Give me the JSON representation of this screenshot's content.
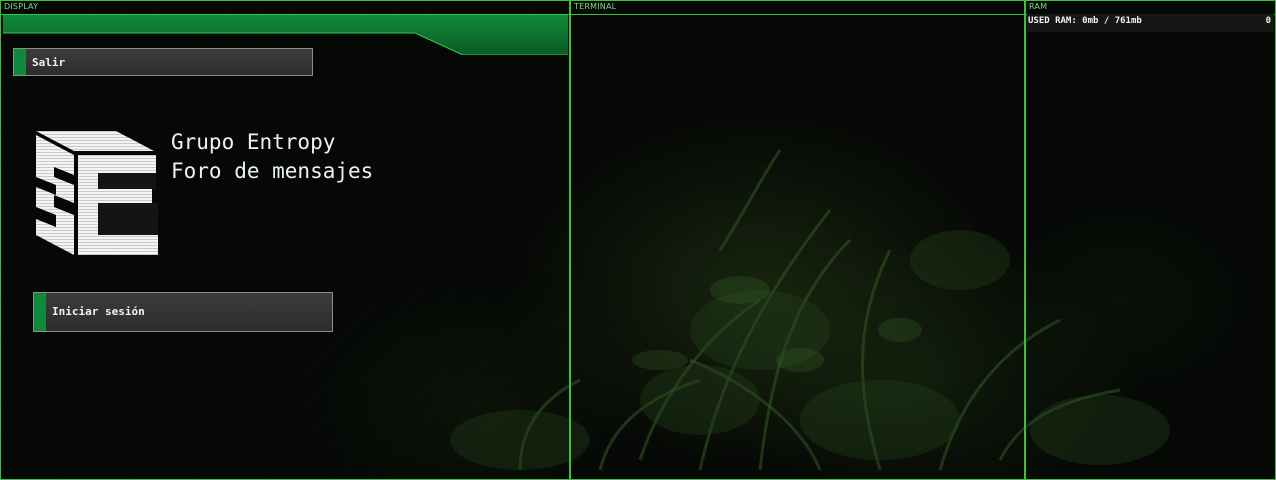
{
  "panels": {
    "display": {
      "title": "DISPLAY",
      "logout_label": "Salir",
      "logo": {
        "name": "grupo-entropy-logo",
        "text": "3E"
      },
      "forum_title_line1": "Grupo Entropy",
      "forum_title_line2": "Foro de mensajes",
      "login_label": "Iniciar sesión"
    },
    "terminal": {
      "title": "TERMINAL"
    },
    "ram": {
      "title": "RAM",
      "used_label": "USED RAM: 0mb / 761mb",
      "count": "0"
    }
  },
  "colors": {
    "border": "#39c23a",
    "accent": "#0f8a3c",
    "header_band": "#0c6b2c",
    "button_bg": "#333633",
    "text": "#f2f2f2",
    "title_text": "#7fd88a"
  }
}
